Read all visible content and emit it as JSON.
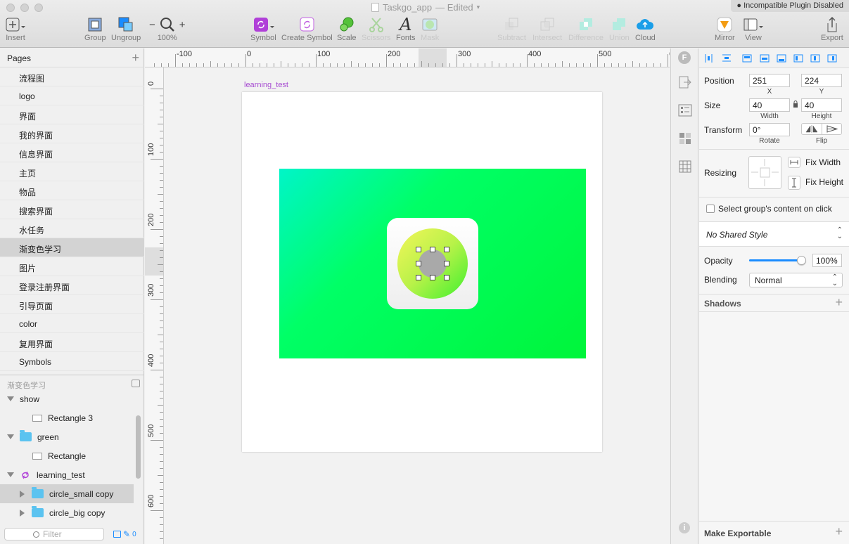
{
  "window": {
    "title": "Taskgo_app",
    "status": "— Edited",
    "plugin_badge": "Incompatible Plugin Disabled"
  },
  "toolbar": {
    "insert": "Insert",
    "group": "Group",
    "ungroup": "Ungroup",
    "zoom": "100%",
    "zoom_minus": "−",
    "zoom_plus": "+",
    "symbol": "Symbol",
    "create_symbol": "Create Symbol",
    "scale": "Scale",
    "scissors": "Scissors",
    "fonts": "Fonts",
    "mask": "Mask",
    "subtract": "Subtract",
    "intersect": "Intersect",
    "difference": "Difference",
    "union": "Union",
    "cloud": "Cloud",
    "mirror": "Mirror",
    "view": "View",
    "export": "Export"
  },
  "pages": {
    "header": "Pages",
    "items": [
      "流程图",
      "logo",
      "界面",
      "我的界面",
      "信息界面",
      "主页",
      "物品",
      "搜索界面",
      "水任务",
      "渐变色学习",
      "图片",
      "登录注册界面",
      "引导页面",
      "color",
      "复用界面",
      "Symbols"
    ],
    "selected_index": 9
  },
  "layers": {
    "header": "渐变色学习",
    "rows": [
      {
        "label": "show",
        "kind": "group-open",
        "indent": 0
      },
      {
        "label": "Rectangle 3",
        "kind": "rect",
        "indent": 2
      },
      {
        "label": "green",
        "kind": "folder-open",
        "indent": 0
      },
      {
        "label": "Rectangle",
        "kind": "rect",
        "indent": 2
      },
      {
        "label": "learning_test",
        "kind": "symbol-open",
        "indent": 0
      },
      {
        "label": "circle_small copy",
        "kind": "folder-closed",
        "indent": 1
      },
      {
        "label": "circle_big copy",
        "kind": "folder-closed",
        "indent": 1
      }
    ],
    "filter_placeholder": "Filter",
    "filter_count": "0"
  },
  "ruler": {
    "top_labels": [
      "-100",
      "0",
      "100",
      "200",
      "300",
      "400",
      "500",
      "6"
    ],
    "left_labels": [
      "0",
      "100",
      "200",
      "300",
      "400",
      "500",
      "600"
    ]
  },
  "canvas": {
    "artboard_name": "learning_test"
  },
  "inspector": {
    "position_label": "Position",
    "x": "251",
    "x_label": "X",
    "y": "224",
    "y_label": "Y",
    "size_label": "Size",
    "width": "40",
    "width_label": "Width",
    "height": "40",
    "height_label": "Height",
    "transform_label": "Transform",
    "rotate": "0°",
    "rotate_label": "Rotate",
    "flip_label": "Flip",
    "resizing_label": "Resizing",
    "fix_width": "Fix Width",
    "fix_height": "Fix Height",
    "select_group_content": "Select group's content on click",
    "shared_style": "No Shared Style",
    "opacity_label": "Opacity",
    "opacity": "100%",
    "opacity_fraction": 1.0,
    "blending_label": "Blending",
    "blending": "Normal",
    "shadows": "Shadows",
    "make_exportable": "Make Exportable"
  },
  "colors": {
    "accent_blue": "#1a8cff",
    "symbol_purple": "#b040d8",
    "folder_blue": "#5bc3f0"
  }
}
